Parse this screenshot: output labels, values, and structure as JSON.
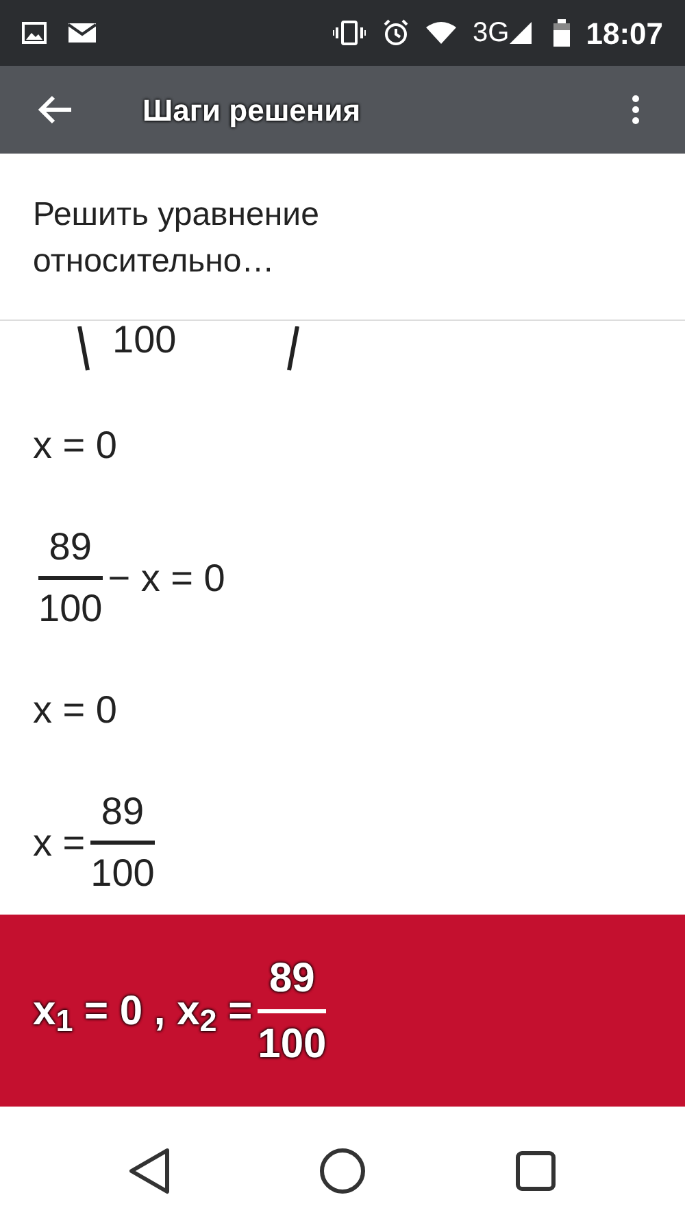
{
  "status_bar": {
    "network": "3G",
    "time": "18:07"
  },
  "app_bar": {
    "title": "Шаги решения"
  },
  "header": {
    "text": "Решить уравнение относительно…"
  },
  "steps": [
    [
      {
        "kind": "cut",
        "text": "100"
      }
    ],
    [
      {
        "kind": "text",
        "text": "x = 0"
      }
    ],
    [
      {
        "kind": "fraction",
        "numerator": "89",
        "denominator": "100"
      },
      {
        "kind": "text",
        "text": "− x = 0"
      }
    ],
    [
      {
        "kind": "text",
        "text": "x = 0"
      }
    ],
    [
      {
        "kind": "text",
        "text": "x ="
      },
      {
        "kind": "fraction",
        "numerator": "89",
        "denominator": "100"
      }
    ]
  ],
  "answer": [
    {
      "kind": "text",
      "text": "x$_{1}$ = 0 , x$_{2}$ ="
    },
    {
      "kind": "fraction",
      "numerator": "89",
      "denominator": "100"
    }
  ]
}
